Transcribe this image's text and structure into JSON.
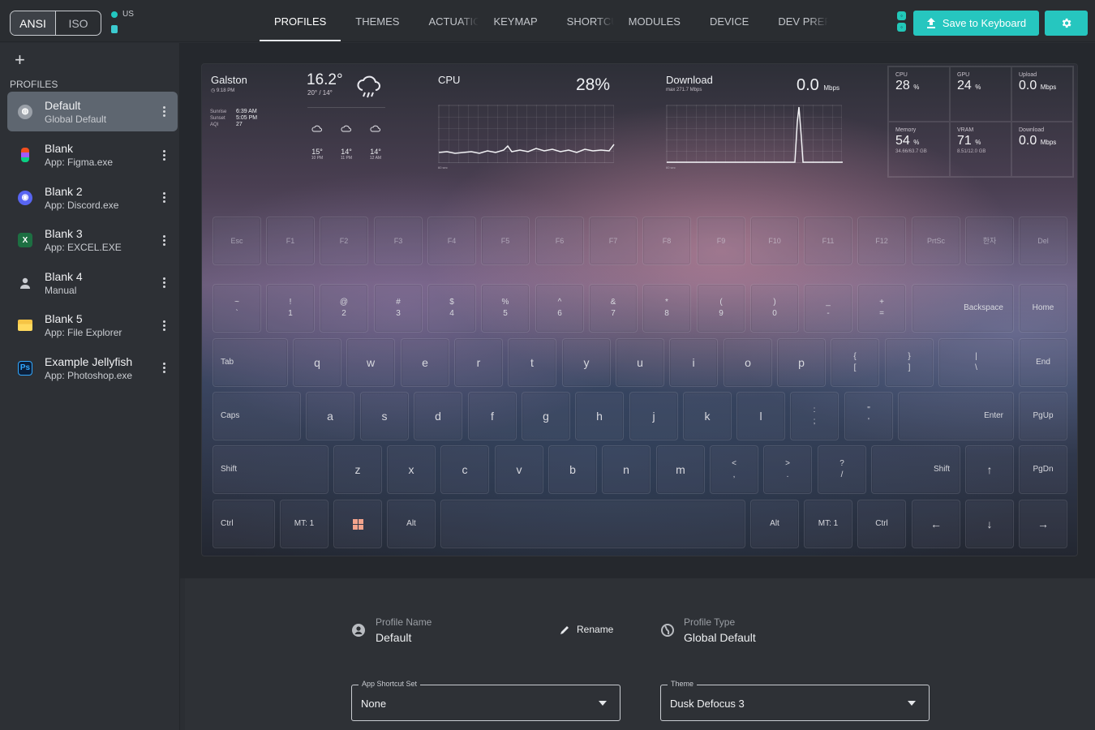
{
  "layout_toggle": {
    "options": [
      "ANSI",
      "ISO"
    ],
    "selected": "ANSI"
  },
  "keyboard_language": "US",
  "tabs": [
    "PROFILES",
    "THEMES",
    "ACTUATIO",
    "KEYMAP",
    "SHORTCU",
    "MODULES",
    "DEVICE",
    "DEV PREFS"
  ],
  "active_tab": "PROFILES",
  "save_label": "Save to Keyboard",
  "sidebar": {
    "heading": "PROFILES",
    "profiles": [
      {
        "name": "Default",
        "sub": "Global Default",
        "icon": "globe-icon",
        "active": true
      },
      {
        "name": "Blank",
        "sub": "App: Figma.exe",
        "icon": "figma-icon"
      },
      {
        "name": "Blank 2",
        "sub": "App: Discord.exe",
        "icon": "discord-icon"
      },
      {
        "name": "Blank 3",
        "sub": "App: EXCEL.EXE",
        "icon": "excel-icon"
      },
      {
        "name": "Blank 4",
        "sub": "Manual",
        "icon": "person-icon"
      },
      {
        "name": "Blank 5",
        "sub": "App: File Explorer",
        "icon": "folder-icon"
      },
      {
        "name": "Example Jellyfish",
        "sub": "App: Photoshop.exe",
        "icon": "photoshop-icon"
      }
    ]
  },
  "weather": {
    "location": "Galston",
    "time": "9:18 PM",
    "temp": "16.2°",
    "range": "20° / 14°",
    "sunrise_label": "Sunrise",
    "sunrise": "6:39 AM",
    "sunset_label": "Sunset",
    "sunset": "5:05 PM",
    "aqi_label": "AQI",
    "aqi": "27",
    "forecast": [
      {
        "temp": "15°",
        "time": "10 PM"
      },
      {
        "temp": "14°",
        "time": "11 PM"
      },
      {
        "temp": "14°",
        "time": "12 AM"
      }
    ]
  },
  "cpu_widget": {
    "label": "CPU",
    "value": "28%",
    "axis": "60 sec"
  },
  "download_widget": {
    "label": "Download",
    "value": "0.0",
    "unit": "Mbps",
    "max": "max 271.7 Mbps",
    "axis": "60 sec"
  },
  "stats": [
    {
      "label": "CPU",
      "value": "28",
      "unit": "%",
      "sub": ""
    },
    {
      "label": "GPU",
      "value": "24",
      "unit": "%",
      "sub": ""
    },
    {
      "label": "Upload",
      "value": "0.0",
      "unit": "Mbps",
      "sub": ""
    },
    {
      "label": "Memory",
      "value": "54",
      "unit": "%",
      "sub": "34.66/63.7 GB"
    },
    {
      "label": "VRAM",
      "value": "71",
      "unit": "%",
      "sub": "8.51/12.0 GB"
    },
    {
      "label": "Download",
      "value": "0.0",
      "unit": "Mbps",
      "sub": ""
    }
  ],
  "keys": {
    "fn_row": [
      "Esc",
      "F1",
      "F2",
      "F3",
      "F4",
      "F5",
      "F6",
      "F7",
      "F8",
      "F9",
      "F10",
      "F11",
      "F12",
      "PrtSc",
      "한자",
      "Del"
    ],
    "num_row": [
      [
        "~",
        "`"
      ],
      [
        "!",
        "1"
      ],
      [
        "@",
        "2"
      ],
      [
        "#",
        "3"
      ],
      [
        "$",
        "4"
      ],
      [
        "%",
        "5"
      ],
      [
        "^",
        "6"
      ],
      [
        "&",
        "7"
      ],
      [
        "*",
        "8"
      ],
      [
        "(",
        "9"
      ],
      [
        ")",
        "0"
      ],
      [
        "_",
        "-"
      ],
      [
        "+",
        "="
      ]
    ],
    "backspace": "Backspace",
    "home": "Home",
    "tab": "Tab",
    "q_row": [
      "q",
      "w",
      "e",
      "r",
      "t",
      "y",
      "u",
      "i",
      "o",
      "p"
    ],
    "q_sym": [
      [
        "{",
        "["
      ],
      [
        "}",
        "]"
      ],
      [
        "|",
        "\\"
      ]
    ],
    "end": "End",
    "caps": "Caps",
    "a_row": [
      "a",
      "s",
      "d",
      "f",
      "g",
      "h",
      "j",
      "k",
      "l"
    ],
    "a_sym": [
      [
        ":",
        ";"
      ],
      [
        "\"",
        "'"
      ]
    ],
    "enter": "Enter",
    "pgup": "PgUp",
    "shift": "Shift",
    "z_row": [
      "z",
      "x",
      "c",
      "v",
      "b",
      "n",
      "m"
    ],
    "z_sym": [
      [
        "<",
        ","
      ],
      [
        ">",
        "."
      ],
      [
        "?",
        "/"
      ]
    ],
    "rshift": "Shift",
    "up": "↑",
    "pgdn": "PgDn",
    "ctrl": "Ctrl",
    "mt1": "MT: 1",
    "alt": "Alt",
    "ralt": "Alt",
    "mt1r": "MT: 1",
    "rctrl": "Ctrl",
    "left": "←",
    "down": "↓",
    "right": "→"
  },
  "profile_form": {
    "name_label": "Profile Name",
    "name_value": "Default",
    "rename_label": "Rename",
    "type_label": "Profile Type",
    "type_value": "Global Default",
    "shortcut_caption": "App Shortcut Set",
    "shortcut_value": "None",
    "theme_caption": "Theme",
    "theme_value": "Dusk Defocus 3"
  }
}
